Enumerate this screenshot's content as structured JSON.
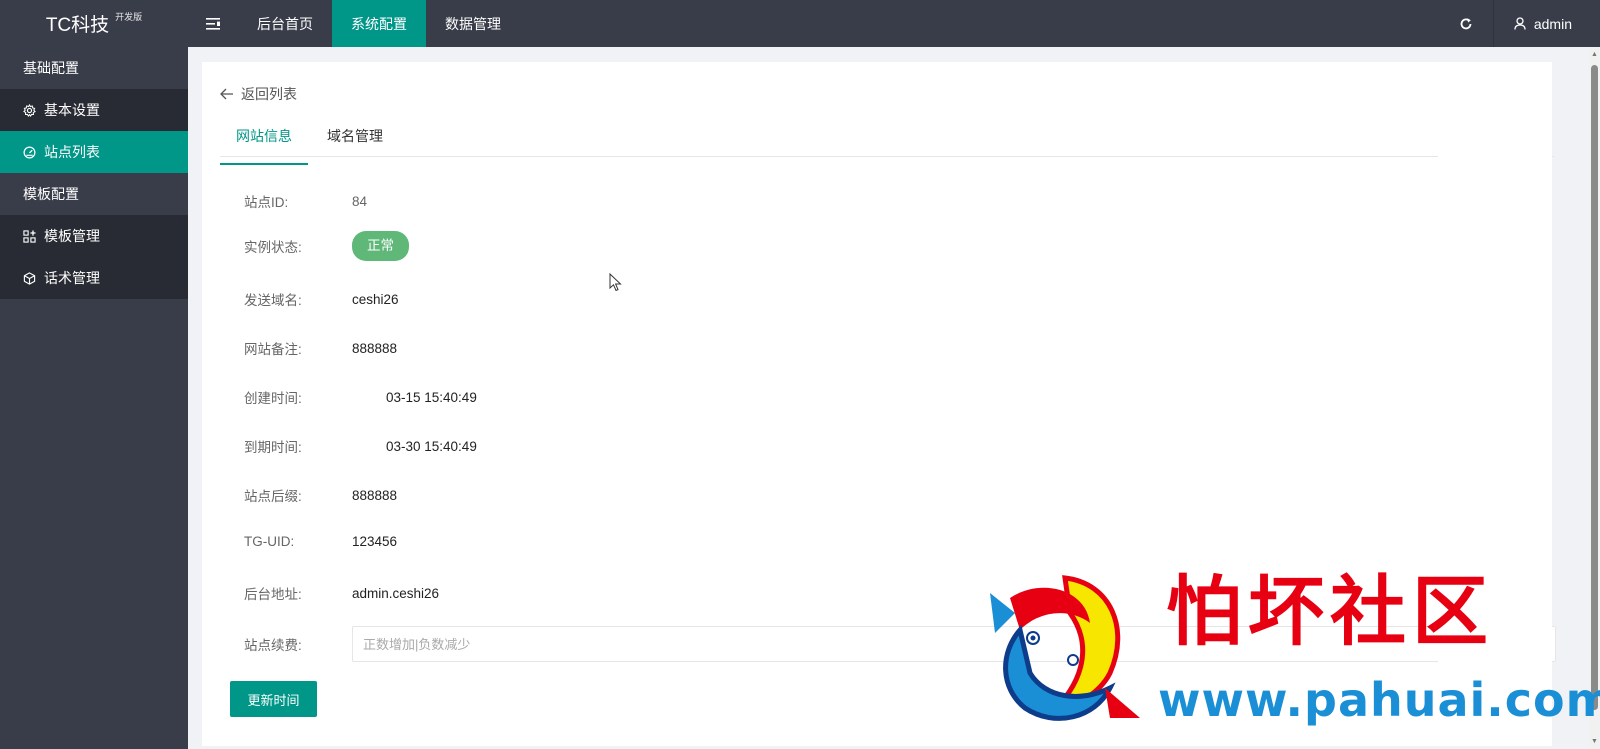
{
  "brand": {
    "name": "TC科技",
    "edition": "开发版"
  },
  "topnav": {
    "items": [
      "后台首页",
      "系统配置",
      "数据管理"
    ],
    "active_index": 1
  },
  "user": {
    "name": "admin"
  },
  "sidebar": {
    "groups": [
      {
        "title": "基础配置",
        "items": [
          {
            "label": "基本设置",
            "icon": "gear-icon"
          },
          {
            "label": "站点列表",
            "icon": "dashboard-icon",
            "active": true
          }
        ]
      },
      {
        "title": "模板配置",
        "items": [
          {
            "label": "模板管理",
            "icon": "grid-icon"
          },
          {
            "label": "话术管理",
            "icon": "cube-icon"
          }
        ]
      }
    ]
  },
  "content": {
    "back_label": "返回列表",
    "tabs": [
      "网站信息",
      "域名管理"
    ],
    "active_tab": 0,
    "fields": [
      {
        "label": "站点ID:",
        "value": "84"
      },
      {
        "label": "实例状态:",
        "value": "正常",
        "type": "badge"
      },
      {
        "label": "发送域名:",
        "value": "ceshi26"
      },
      {
        "label": "网站备注:",
        "value": "888888"
      },
      {
        "label": "创建时间:",
        "value": "03-15 15:40:49"
      },
      {
        "label": "到期时间:",
        "value": "03-30 15:40:49"
      },
      {
        "label": "站点后缀:",
        "value": "888888"
      },
      {
        "label": "TG-UID:",
        "value": "123456"
      },
      {
        "label": "后台地址:",
        "value": "admin.ceshi26"
      }
    ],
    "renew": {
      "label": "站点续费:",
      "placeholder": "正数增加|负数减少"
    },
    "update_button": "更新时间"
  },
  "watermark": {
    "text": "怕坏社区",
    "url": "www.pahuai.com"
  },
  "colors": {
    "topbar": "#393d49",
    "accent": "#009688",
    "sidebar_item": "#282b33",
    "badge": "#5fb878",
    "watermark_red": "#e60012",
    "watermark_blue": "#1a8fd6"
  }
}
